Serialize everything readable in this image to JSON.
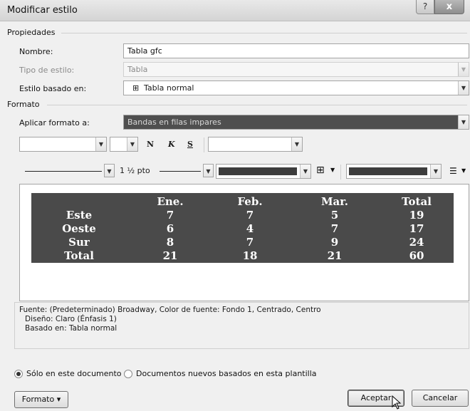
{
  "window": {
    "title": "Modificar estilo",
    "help": "?",
    "close": "x"
  },
  "properties": {
    "heading": "Propiedades",
    "name_label": "Nombre:",
    "name_value": "Tabla gfc",
    "type_label": "Tipo de estilo:",
    "type_value": "Tabla",
    "based_label": "Estilo basado en:",
    "based_icon": "table-icon",
    "based_icon_glyph": "⊞",
    "based_value": "Tabla normal"
  },
  "format": {
    "heading": "Formato",
    "apply_label": "Aplicar formato a:",
    "apply_value": "Bandas en filas impares",
    "bold": "N",
    "italic": "K",
    "underline": "S",
    "line_width": "1 ½ pto",
    "border_icon": "⊞",
    "align_icon": "☰"
  },
  "preview": {
    "header": [
      "",
      "Ene.",
      "Feb.",
      "Mar.",
      "Total"
    ],
    "rows": [
      [
        "Este",
        "7",
        "7",
        "5",
        "19"
      ],
      [
        "Oeste",
        "6",
        "4",
        "7",
        "17"
      ],
      [
        "Sur",
        "8",
        "7",
        "9",
        "24"
      ],
      [
        "Total",
        "21",
        "18",
        "21",
        "60"
      ]
    ]
  },
  "description": {
    "line1": "Fuente: (Predeterminado) Broadway, Color de fuente: Fondo 1, Centrado, Centro",
    "line2": "Diseño: Claro (Énfasis 1)",
    "line3": "Basado en: Tabla normal"
  },
  "scope": {
    "option_doc": "Sólo en este documento",
    "option_template": "Documentos nuevos basados en esta plantilla"
  },
  "buttons": {
    "format": "Formato ▾",
    "accept": "Aceptar",
    "cancel": "Cancelar"
  },
  "colors": {
    "table_fill": "#4a4a4a",
    "highlight": "#4f4f4f"
  }
}
